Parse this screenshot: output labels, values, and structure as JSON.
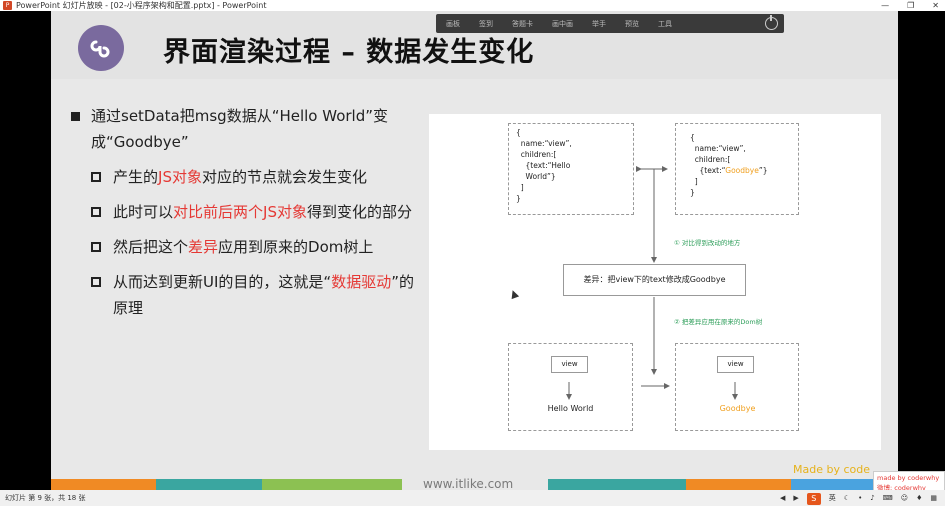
{
  "window": {
    "title": "PowerPoint 幻灯片放映 - [02-小程序架构和配置.pptx] - PowerPoint",
    "controls": [
      "—",
      "❐",
      "✕"
    ]
  },
  "presenter_toolbar": {
    "items": [
      "画板",
      "签到",
      "答题卡",
      "画中画",
      "举手",
      "预览",
      "工具"
    ]
  },
  "slide": {
    "title": "界面渲染过程 – 数据发生变化",
    "bullets": {
      "main_part1": "通过setData把msg数据从“Hello World”变成“Goodbye”",
      "sub1_a": "产生的",
      "sub1_red": "JS对象",
      "sub1_b": "对应的节点就会发生变化",
      "sub2_a": "此时可以",
      "sub2_red": "对比前后两个JS对象",
      "sub2_b": "得到变化的部分",
      "sub3_a": "然后把这个",
      "sub3_red": "差异",
      "sub3_b": "应用到原来的Dom树上",
      "sub4_a": "从而达到更新UI的目的，这就是“",
      "sub4_red": "数据驱动",
      "sub4_b": "”的原理"
    },
    "diagram": {
      "left_obj_lines": [
        "{",
        "  name:“view”,",
        "  children:[",
        "    {text:“Hello",
        "    World”}",
        "  ]",
        "}"
      ],
      "right_obj_l1": "{",
      "right_obj_l2": "  name:“view”,",
      "right_obj_l3": "  children:[",
      "right_obj_l4a": "    {text:“",
      "right_obj_l4b": "Goodbye",
      "right_obj_l4c": "”}",
      "right_obj_l5": "  ]",
      "right_obj_l6": "}",
      "step1": "① 对比得到改动的地方",
      "diff_text": "差异：把view下的text修改成Goodbye",
      "step2": "② 把差异应用在原来的Dom树",
      "left_node": "view",
      "left_text": "Hello World",
      "right_node": "view",
      "right_text": "Goodbye"
    },
    "url": "www.itlike.com",
    "made_by": "Made by code",
    "watermark_l1": "made by coderwhy",
    "watermark_l2": "微博: coderwhy"
  },
  "status": {
    "slide_info": "幻灯片 第 9 张，共 18 张",
    "ime": "英"
  },
  "colors": {
    "accent_red": "#e53935",
    "goodbye_orange": "#f0a020",
    "step_green": "#2e9e5a",
    "bar": [
      "#f08a24",
      "#3aa6a0",
      "#8cc152",
      "#f08a24",
      "#3aa6a0",
      "#8cc152",
      "#f08a24",
      "#4aa3df"
    ]
  }
}
